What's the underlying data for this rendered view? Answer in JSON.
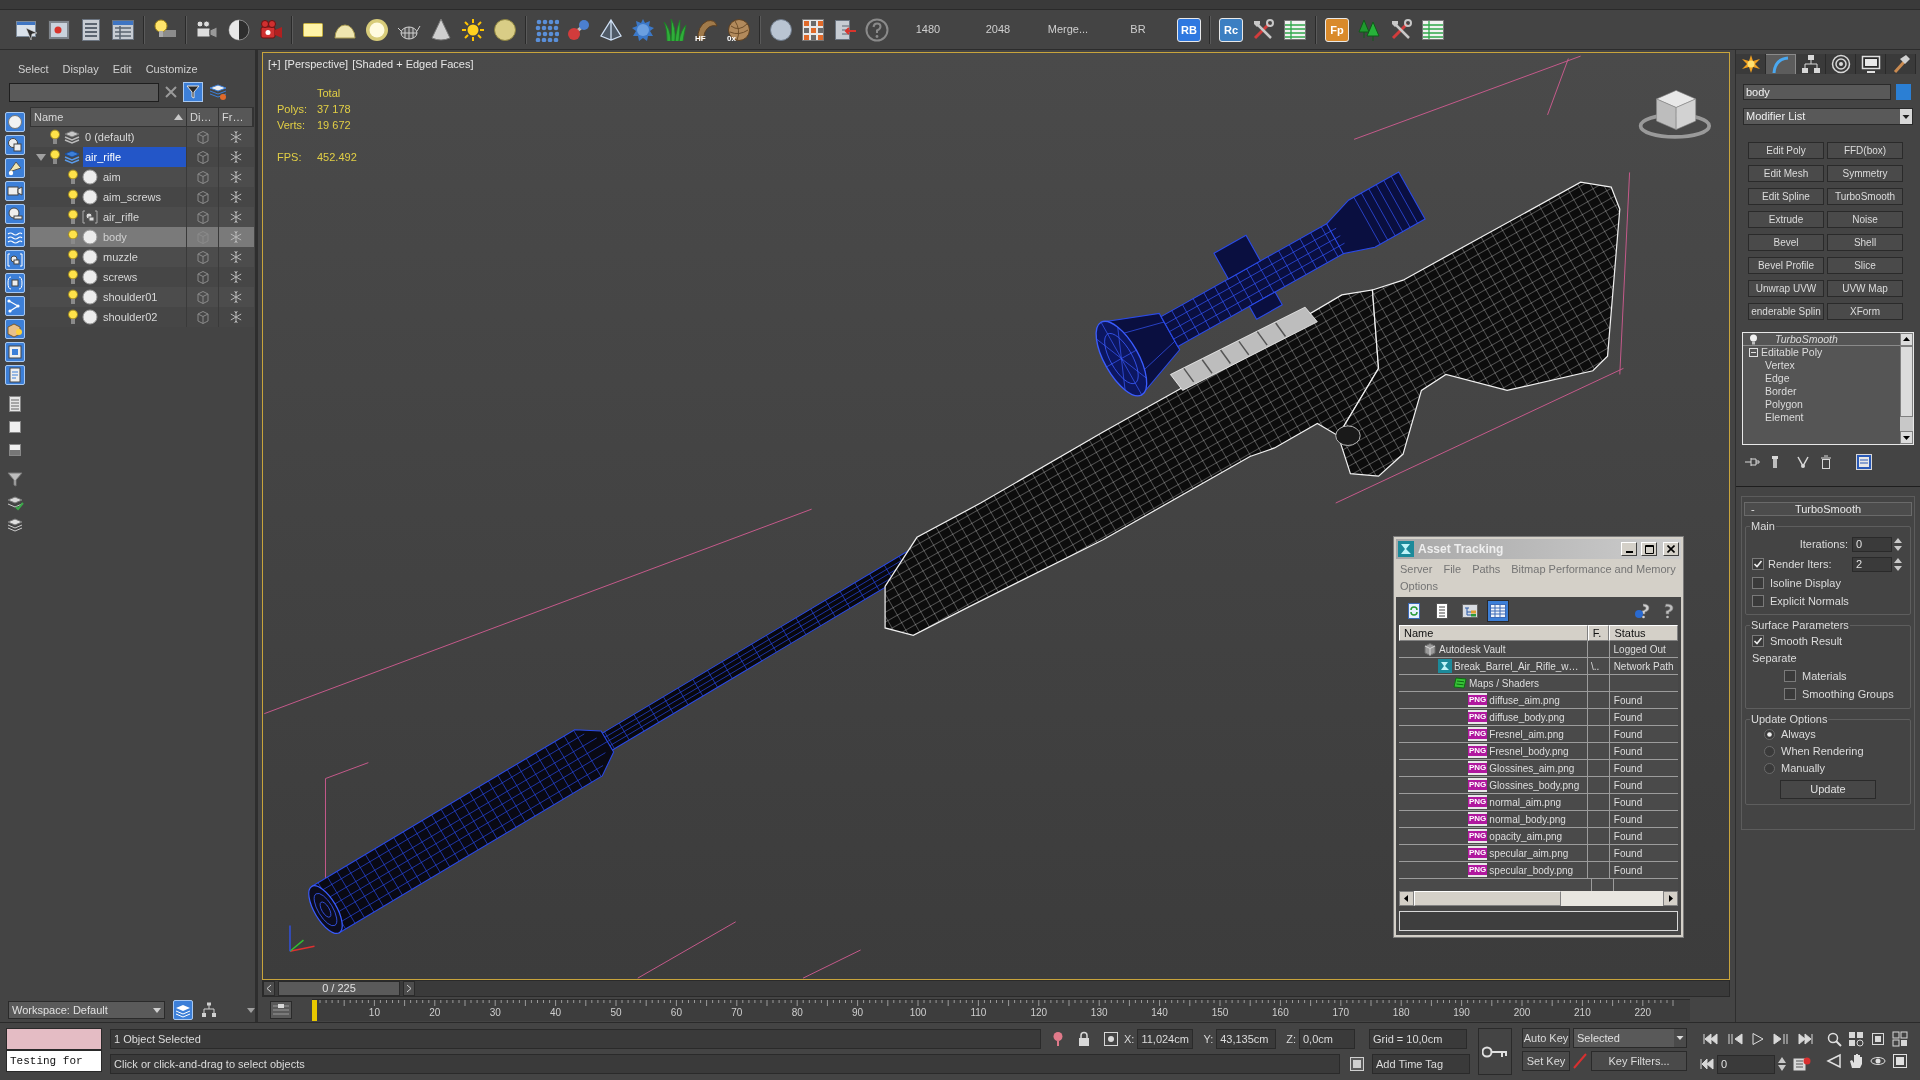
{
  "main_toolbar": {
    "icon_captions": [
      "HF",
      "0x"
    ],
    "presets": [
      "1480",
      "2048",
      "Merge...",
      "BR"
    ],
    "badges": [
      {
        "text": "RB",
        "color": "#2f78e0"
      },
      {
        "text": "Rc",
        "color": "#3c7fc2"
      },
      {
        "text": "Fp",
        "color": "#d98a2b"
      }
    ]
  },
  "scene_explorer": {
    "menu": [
      "Select",
      "Display",
      "Edit",
      "Customize"
    ],
    "filter_active": true,
    "columns": [
      {
        "label": "Name",
        "sorted": true
      },
      {
        "label": "Di…",
        "sorted": false
      },
      {
        "label": "Fr…",
        "sorted": false
      }
    ],
    "tree": [
      {
        "name": "0 (default)",
        "kind": "layer",
        "current": false,
        "expanded": false,
        "selected": false
      },
      {
        "name": "air_rifle",
        "kind": "layer",
        "current": true,
        "expanded": true,
        "selected": false,
        "children": [
          {
            "name": "aim",
            "kind": "object",
            "selected": false
          },
          {
            "name": "aim_screws",
            "kind": "object",
            "selected": false
          },
          {
            "name": "air_rifle",
            "kind": "group",
            "selected": false
          },
          {
            "name": "body",
            "kind": "object",
            "selected": true
          },
          {
            "name": "muzzle",
            "kind": "object",
            "selected": false
          },
          {
            "name": "screws",
            "kind": "object",
            "selected": false
          },
          {
            "name": "shoulder01",
            "kind": "object",
            "selected": false
          },
          {
            "name": "shoulder02",
            "kind": "object",
            "selected": false
          }
        ]
      }
    ]
  },
  "workspace": "Workspace: Default",
  "viewport": {
    "active": true,
    "labels": [
      "[+]",
      "[Perspective]",
      "[Shaded + Edged Faces]"
    ],
    "stats": {
      "heading": "Total",
      "rows": [
        {
          "label": "Polys:",
          "value": "37 178"
        },
        {
          "label": "Verts:",
          "value": "19 672"
        }
      ],
      "fps": {
        "label": "FPS:",
        "value": "452.492"
      }
    }
  },
  "asset_tracking": {
    "title": "Asset Tracking",
    "menu": [
      "Server",
      "File",
      "Paths",
      "Bitmap Performance and Memory",
      "Options"
    ],
    "view_buttons": [
      {
        "selected": false
      },
      {
        "selected": false
      },
      {
        "selected": false
      },
      {
        "selected": true
      }
    ],
    "columns": [
      "Name",
      "F.",
      "Status"
    ],
    "rows": [
      {
        "name": "Autodesk Vault",
        "kind": "vault",
        "status": "Logged Out",
        "children": [
          {
            "name": "Break_Barrel_Air_Rifle_w…",
            "kind": "scene",
            "path": "\\..",
            "status": "Network Path",
            "children": [
              {
                "name": "Maps / Shaders",
                "kind": "folder",
                "children": [
                  {
                    "name": "diffuse_aim.png",
                    "kind": "file",
                    "type": "PNG",
                    "status": "Found"
                  },
                  {
                    "name": "diffuse_body.png",
                    "kind": "file",
                    "type": "PNG",
                    "status": "Found"
                  },
                  {
                    "name": "Fresnel_aim.png",
                    "kind": "file",
                    "type": "PNG",
                    "status": "Found"
                  },
                  {
                    "name": "Fresnel_body.png",
                    "kind": "file",
                    "type": "PNG",
                    "status": "Found"
                  },
                  {
                    "name": "Glossines_aim.png",
                    "kind": "file",
                    "type": "PNG",
                    "status": "Found"
                  },
                  {
                    "name": "Glossines_body.png",
                    "kind": "file",
                    "type": "PNG",
                    "status": "Found"
                  },
                  {
                    "name": "normal_aim.png",
                    "kind": "file",
                    "type": "PNG",
                    "status": "Found"
                  },
                  {
                    "name": "normal_body.png",
                    "kind": "file",
                    "type": "PNG",
                    "status": "Found"
                  },
                  {
                    "name": "opacity_aim.png",
                    "kind": "file",
                    "type": "PNG",
                    "status": "Found"
                  },
                  {
                    "name": "specular_aim.png",
                    "kind": "file",
                    "type": "PNG",
                    "status": "Found"
                  },
                  {
                    "name": "specular_body.png",
                    "kind": "file",
                    "type": "PNG",
                    "status": "Found"
                  }
                ]
              }
            ]
          }
        ]
      }
    ]
  },
  "time_slider": {
    "position": "0 / 225",
    "level": 0
  },
  "trackbar": {
    "labels": [
      "10",
      "20",
      "30",
      "40",
      "50",
      "60",
      "70",
      "80",
      "90",
      "100",
      "110",
      "120",
      "130",
      "140",
      "150",
      "160",
      "170",
      "180",
      "190",
      "200",
      "210",
      "220"
    ]
  },
  "command_panel": {
    "tabs": [
      {
        "selected": false
      },
      {
        "selected": true
      },
      {
        "selected": false
      },
      {
        "selected": false
      },
      {
        "selected": false
      },
      {
        "selected": false
      }
    ],
    "object_name": {
      "value": "body",
      "color": "#2b7fd4"
    },
    "modifier_list": "Modifier List",
    "modifier_buttons": [
      "Edit Poly",
      "FFD(box)",
      "Edit Mesh",
      "Symmetry",
      "Edit Spline",
      "TurboSmooth",
      "Extrude",
      "Noise",
      "Bevel",
      "Shell",
      "Bevel Profile",
      "Slice",
      "Unwrap UVW",
      "UVW Map",
      "enderable Splin",
      "XForm"
    ],
    "stack": [
      {
        "name": "TurboSmooth",
        "kind": "modifier",
        "on": true
      },
      {
        "name": "Editable Poly",
        "kind": "object",
        "expanded": true,
        "children": [
          {
            "name": "Vertex"
          },
          {
            "name": "Edge"
          },
          {
            "name": "Border"
          },
          {
            "name": "Polygon"
          },
          {
            "name": "Element"
          }
        ]
      }
    ],
    "rollout": {
      "toggle": "-",
      "title": "TurboSmooth",
      "groups": [
        {
          "title": "Main",
          "controls": [
            {
              "kind": "spinner",
              "label": "Iterations:",
              "value": "0"
            },
            {
              "kind": "check_spinner",
              "label": "Render Iters:",
              "checked": true,
              "value": "2"
            },
            {
              "kind": "checkbox",
              "label": "Isoline Display",
              "checked": false
            },
            {
              "kind": "checkbox",
              "label": "Explicit Normals",
              "checked": false
            }
          ]
        },
        {
          "title": "Surface Parameters",
          "controls": [
            {
              "kind": "checkbox",
              "label": "Smooth Result",
              "checked": true
            },
            {
              "kind": "heading",
              "label": "Separate",
              "children": [
                {
                  "kind": "checkbox",
                  "label": "Materials",
                  "checked": false
                },
                {
                  "kind": "checkbox",
                  "label": "Smoothing Groups",
                  "checked": false
                }
              ]
            }
          ]
        },
        {
          "title": "Update Options",
          "controls": [
            {
              "kind": "radio",
              "label": "Always",
              "selected": true
            },
            {
              "kind": "radio",
              "label": "When Rendering",
              "selected": false
            },
            {
              "kind": "radio",
              "label": "Manually",
              "selected": false
            },
            {
              "kind": "button",
              "label": "Update"
            }
          ]
        }
      ]
    }
  },
  "status_bar": {
    "listener": "Testing for",
    "selection": "1 Object Selected",
    "prompt": "Click or click-and-drag to select objects",
    "coordinates": [
      {
        "axis": "X:",
        "value": "11,024cm"
      },
      {
        "axis": "Y:",
        "value": "43,135cm"
      },
      {
        "axis": "Z:",
        "value": "0,0cm"
      }
    ],
    "grid": "Grid = 10,0cm",
    "time_tag": "Add Time Tag",
    "auto_key": {
      "label": "Auto Key",
      "on": false
    },
    "key_mode": "Selected",
    "set_key": "Set Key",
    "key_filters": "Key Filters...",
    "frame": "0"
  }
}
